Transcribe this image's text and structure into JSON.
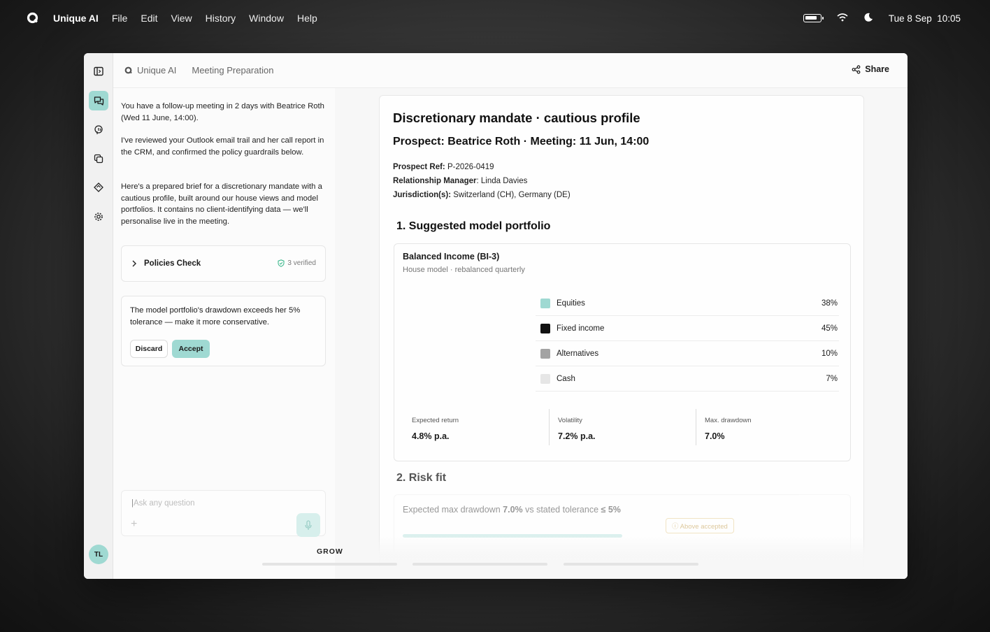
{
  "menubar": {
    "app_name": "Unique AI",
    "menus": [
      "File",
      "Edit",
      "View",
      "History",
      "Window",
      "Help"
    ],
    "datetime": "Tue 8 Sep  10:05"
  },
  "topbar": {
    "breadcrumb_app": "Unique AI",
    "breadcrumb_page": "Meeting Preparation",
    "share_label": "Share"
  },
  "rail": {
    "avatar_initials": "TL"
  },
  "chat": {
    "p1": "You have a follow-up meeting in 2 days with Beatrice Roth (Wed 11 June, 14:00).",
    "p2": "I've reviewed your Outlook email trail and her call report in the CRM, and confirmed the policy guardrails below.",
    "p3": "Here's a prepared brief for a discretionary mandate with a cautious profile, built around our house views and model portfolios. It contains no client-identifying data — we'll personalise live in the meeting.",
    "policies_title": "Policies Check",
    "policies_verified": "3 verified",
    "suggestion": "The model portfolio's drawdown exceeds her 5% tolerance — make it more conservative.",
    "discard_label": "Discard",
    "accept_label": "Accept",
    "ask_placeholder": "Ask any question",
    "plus": "+"
  },
  "doc": {
    "title": "Discretionary mandate · cautious profile",
    "subtitle": "Prospect: Beatrice Roth · Meeting: 11 Jun, 14:00",
    "prospect_ref_label": "Prospect Ref:",
    "prospect_ref": "P-2026-0419",
    "rm_label": "Relationship Manager",
    "rm": ": Linda Davies",
    "jurisdiction_label": "Jurisdiction(s):",
    "jurisdiction": "Switzerland (CH), Germany (DE)",
    "section1": "1. Suggested model portfolio",
    "portfolio_name": "Balanced Income (BI-3)",
    "portfolio_sub": "House model · rebalanced quarterly",
    "allocation": [
      {
        "label": "Equities",
        "pct": "38%",
        "color": "#9fd9d2"
      },
      {
        "label": "Fixed income",
        "pct": "45%",
        "color": "#111111"
      },
      {
        "label": "Alternatives",
        "pct": "10%",
        "color": "#a3a3a3"
      },
      {
        "label": "Cash",
        "pct": "7%",
        "color": "#e6e6e6"
      }
    ],
    "stats": [
      {
        "label": "Expected return",
        "value": "4.8% p.a."
      },
      {
        "label": "Volatility",
        "value": "7.2% p.a."
      },
      {
        "label": "Max. drawdown",
        "value": "7.0%"
      }
    ],
    "section2": "2. Risk fit",
    "risk_line_pre": "Expected max drawdown ",
    "risk_line_val": "7.0%",
    "risk_line_mid": " vs stated tolerance ",
    "risk_line_tol": "≤ 5%",
    "risk_badge": "Above accepted"
  },
  "footer": {
    "grow_label": "GROW"
  },
  "colors": {
    "accent": "#9fd9d2",
    "accent_light": "#d7efec"
  }
}
